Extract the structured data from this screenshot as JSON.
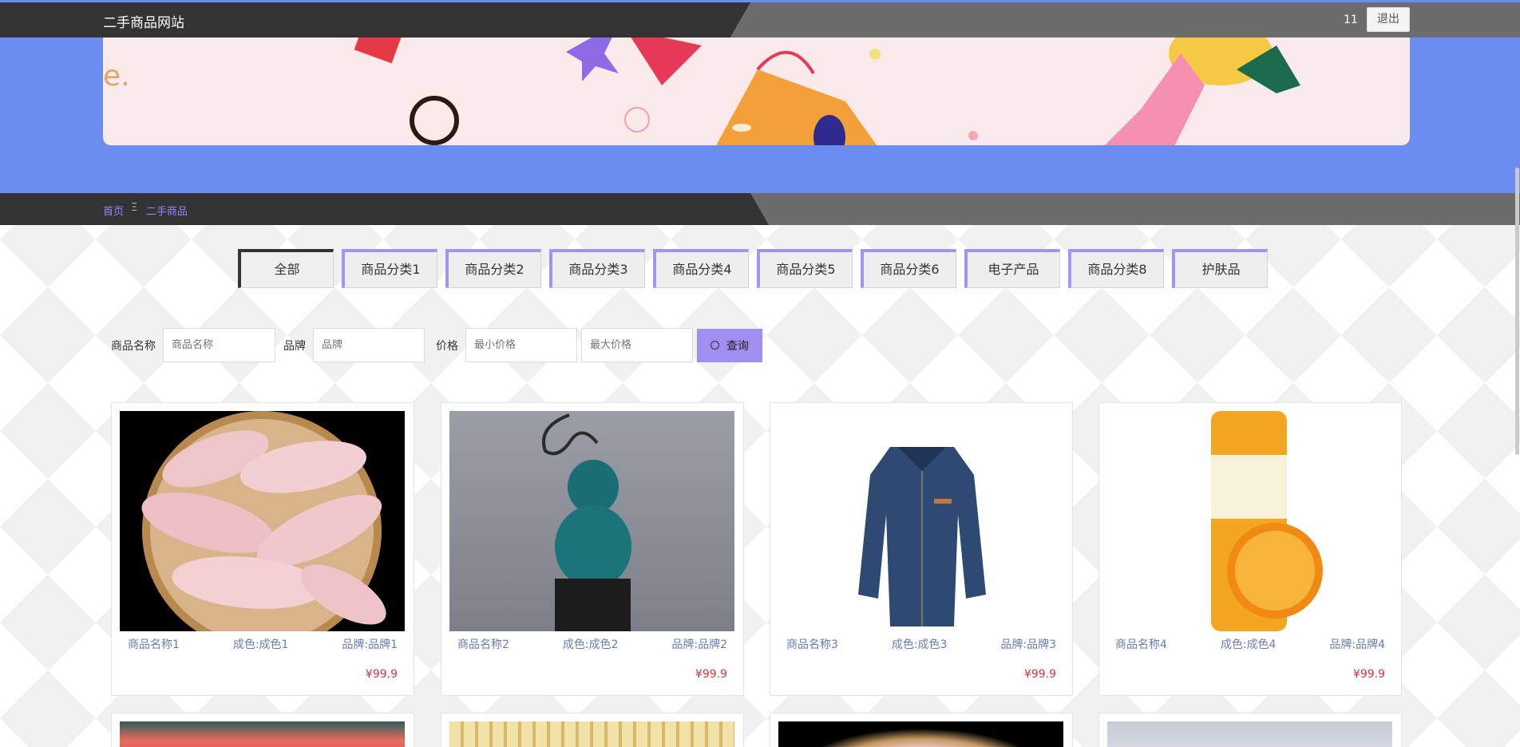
{
  "header": {
    "site_title": "二手商品网站",
    "username": "11",
    "logout_label": "退出"
  },
  "breadcrumb": {
    "home": "首页",
    "separator": "Ξ",
    "current": "二手商品"
  },
  "tabs": [
    {
      "label": "全部",
      "active": true
    },
    {
      "label": "商品分类1"
    },
    {
      "label": "商品分类2"
    },
    {
      "label": "商品分类3"
    },
    {
      "label": "商品分类4"
    },
    {
      "label": "商品分类5"
    },
    {
      "label": "商品分类6"
    },
    {
      "label": "电子产品"
    },
    {
      "label": "商品分类8"
    },
    {
      "label": "护肤品"
    }
  ],
  "search": {
    "name_label": "商品名称",
    "name_placeholder": "商品名称",
    "brand_label": "品牌",
    "brand_placeholder": "品牌",
    "price_label": "价格",
    "min_placeholder": "最小价格",
    "max_placeholder": "最大价格",
    "button_label": "查询"
  },
  "products": [
    {
      "name": "商品名称1",
      "condition": "成色:成色1",
      "brand": "品牌:品牌1",
      "price": "¥99.9"
    },
    {
      "name": "商品名称2",
      "condition": "成色:成色2",
      "brand": "品牌:品牌2",
      "price": "¥99.9"
    },
    {
      "name": "商品名称3",
      "condition": "成色:成色3",
      "brand": "品牌:品牌3",
      "price": "¥99.9"
    },
    {
      "name": "商品名称4",
      "condition": "成色:成色4",
      "brand": "品牌:品牌4",
      "price": "¥99.9"
    }
  ],
  "colors": {
    "accent": "#a593f0",
    "header": "#333333",
    "band": "#6b8df0",
    "price": "#e0313c"
  }
}
